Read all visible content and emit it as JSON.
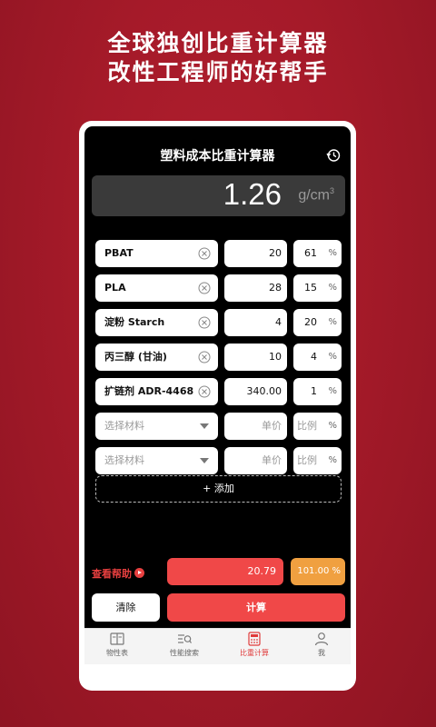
{
  "headline": {
    "line1": "全球独创比重计算器",
    "line2": "改性工程师的好帮手"
  },
  "app": {
    "title": "塑料成本比重计算器",
    "result_value": "1.26",
    "result_unit": "g/cm",
    "result_unit_exp": "3"
  },
  "materials": [
    {
      "name": "PBAT",
      "price": "20",
      "ratio": "61",
      "pct": "%"
    },
    {
      "name": "PLA",
      "price": "28",
      "ratio": "15",
      "pct": "%"
    },
    {
      "name": "淀粉 Starch",
      "price": "4",
      "ratio": "20",
      "pct": "%"
    },
    {
      "name": "丙三醇 (甘油)",
      "price": "10",
      "ratio": "4",
      "pct": "%"
    },
    {
      "name": "扩链剂 ADR-4468",
      "price": "340.00",
      "ratio": "1",
      "pct": "%"
    }
  ],
  "empty_rows": [
    {
      "name_ph": "选择材料",
      "price_ph": "单价",
      "ratio_ph": "比例",
      "pct": "%"
    },
    {
      "name_ph": "选择材料",
      "price_ph": "单价",
      "ratio_ph": "比例",
      "pct": "%"
    }
  ],
  "add_label": "+ 添加",
  "help_label": "查看帮助",
  "cost_value": "20.79",
  "total_pct": "101.00 %",
  "clear_label": "清除",
  "calc_label": "计算",
  "tabs": [
    {
      "label": "物性表",
      "icon": "book-icon"
    },
    {
      "label": "性能搜索",
      "icon": "search-list-icon"
    },
    {
      "label": "比重计算",
      "icon": "calculator-icon",
      "active": true
    },
    {
      "label": "我",
      "icon": "person-icon"
    }
  ],
  "colors": {
    "background": "#a51a29",
    "accent_red": "#f04848",
    "accent_orange": "#f0a040",
    "tab_active": "#e03a3a"
  }
}
